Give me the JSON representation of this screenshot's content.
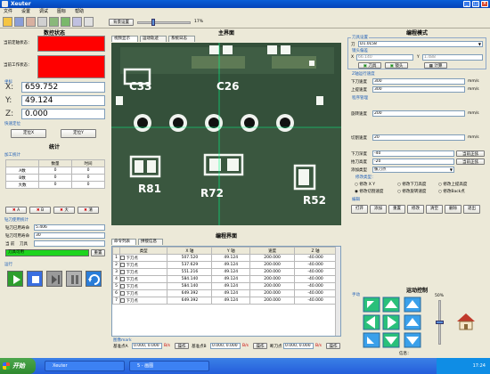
{
  "window": {
    "title": "Xeuter"
  },
  "menu": [
    "文件",
    "设置",
    "调试",
    "图标",
    "帮助"
  ],
  "toolbar": {
    "speed_button": "背景设置",
    "speed_value": "17%"
  },
  "left": {
    "title": "数控状态",
    "current_position_label": "当前定轴状态：",
    "current_work_label": "当前工作状态：",
    "coord_group": "坐标",
    "x_label": "X:",
    "x_value": "659.752",
    "y_label": "Y:",
    "y_value": "49.124",
    "z_label": "Z:",
    "z_value": "0.000",
    "quick_locate": "快速定位",
    "locate_x_button": "定位X",
    "locate_y_button": "定位Y",
    "stats_title": "统计",
    "process_stats": "加工统计",
    "table_headers": [
      "",
      "数量",
      "时间"
    ],
    "table_rows": [
      [
        "A数",
        "0",
        "0"
      ],
      [
        "B数",
        "0",
        "0"
      ],
      [
        "大数",
        "0",
        "0"
      ]
    ],
    "clear_buttons": [
      "A",
      "B",
      "大",
      "清"
    ],
    "tool_stats": "钻刀使用统计",
    "tool_rows": [
      {
        "label": "钻刀已用寿命",
        "value": "5.406"
      },
      {
        "label": "钻刀可用寿命",
        "value": "30"
      }
    ],
    "current_label": "当   前",
    "current_tool": "刀具",
    "current_tool_value": "刀具可用",
    "reset_button": "重置",
    "run_group": "运行"
  },
  "center": {
    "title": "主界面",
    "tabs": [
      "视频显示",
      "运动轨迹",
      "系统日志"
    ],
    "board_labels": [
      "C33",
      "C26",
      "R81",
      "R72",
      "R52"
    ],
    "program_title": "编程界面",
    "program_tabs": [
      "命令列表",
      "拼接信息"
    ],
    "program_headers": [
      "",
      "类型",
      "X 轴",
      "Y 轴",
      "速度",
      "Z 轴"
    ],
    "program_rows": [
      [
        "1",
        "下刀点",
        "507.520",
        "49.124",
        "200.000",
        "-40.000"
      ],
      [
        "2",
        "下刀点",
        "537.629",
        "49.124",
        "200.000",
        "-40.000"
      ],
      [
        "3",
        "下刀点",
        "551.216",
        "49.124",
        "200.000",
        "-40.000"
      ],
      [
        "4",
        "下刀点",
        "584.140",
        "49.124",
        "200.000",
        "-40.000"
      ],
      [
        "5",
        "下刀点",
        "584.140",
        "49.124",
        "200.000",
        "-40.000"
      ],
      [
        "6",
        "下刀点",
        "649.392",
        "49.124",
        "200.000",
        "-40.000"
      ],
      [
        "7",
        "下刀点",
        "649.392",
        "49.124",
        "200.000",
        "-40.000"
      ]
    ],
    "bottom_label": "图像mark",
    "bottom_row": {
      "base1": "基准点A",
      "base1_val": "0.000, 0.000",
      "base1_unit": "B/s",
      "btn1": "操作",
      "base2": "基准点B",
      "base2_val": "0.000, 0.000",
      "base2_unit": "B/s",
      "btn2": "操作",
      "base3": "断刀点",
      "base3_val": "0.000, 0.000",
      "base3_unit": "B/s",
      "btn3": "操作"
    }
  },
  "right": {
    "title": "编程模式",
    "tool_settings": "刀具设置",
    "tool_label": "刀",
    "tool_value": "D1.0L58",
    "lens_label": "镜头偏差",
    "lens_x": "66.140",
    "lens_y": "1.488",
    "tool_btn": "刀具",
    "lens_btn": "镜头",
    "calc_btn": "计算",
    "speed_group": "Z轴运行速度",
    "down_speed_label": "下刀速度",
    "down_speed": "300",
    "speed_unit": "mm/s",
    "up_speed_label": "上提速度",
    "up_speed": "300",
    "program_mgmt": "程序管理",
    "rotate_speed_label": "旋转速度",
    "rotate_speed": "200",
    "cut_speed_label": "切割速度",
    "cut_speed": "20",
    "down_depth_label": "下刀深度",
    "down_depth": "-40",
    "lift_label": "抬刀高度",
    "lift": "-20",
    "current_btn": "当前正弦",
    "current_btn2": "当前正弦",
    "add_type_label": "添加类型",
    "add_type": "拔刀点",
    "modify_group": "修改类型：",
    "radio_options": [
      "修改 X Y",
      "修改下刀高度",
      "修改上提高度",
      "修改切割速度",
      "修改旋转速度",
      "修改Back点"
    ],
    "edit_group": "编辑",
    "edit_buttons": [
      "打开",
      "添加",
      "重置",
      "修改",
      "清空",
      "删除",
      "退出"
    ],
    "motion_title": "运动控制",
    "manual_label": "手动",
    "percent": "50%",
    "status_label": "信息："
  },
  "taskbar": {
    "start": "开始",
    "tasks": [
      "Xeuter",
      "5 - 画图"
    ],
    "time": "17:24"
  }
}
